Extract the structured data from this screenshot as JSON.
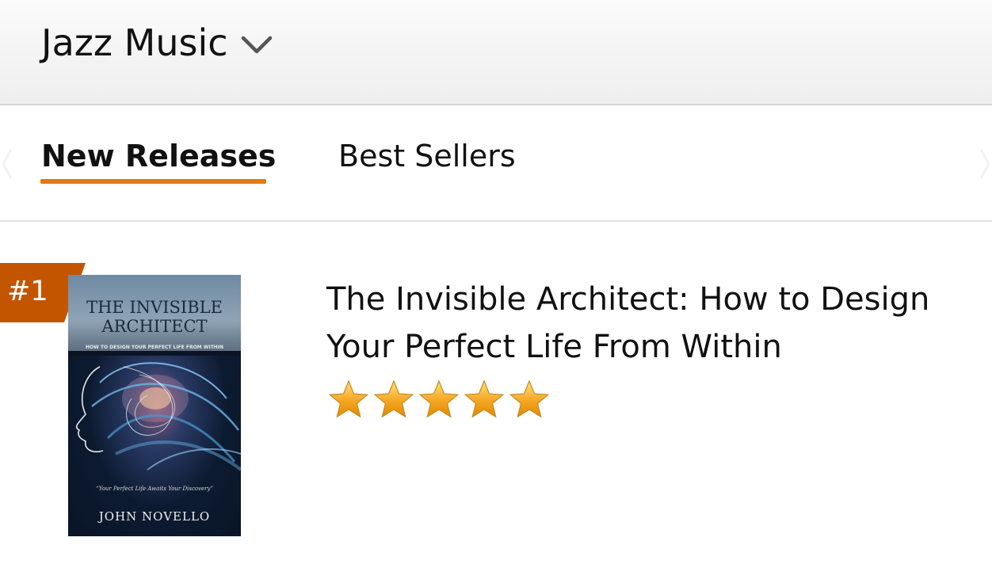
{
  "header": {
    "category": "Jazz Music",
    "dropdown_icon": "chevron-down-icon"
  },
  "tabs": [
    {
      "label": "New Releases",
      "active": true
    },
    {
      "label": "Best Sellers",
      "active": false
    }
  ],
  "colors": {
    "accent": "#e47911",
    "rank_badge": "#c45500",
    "star": "#f5a623"
  },
  "items": [
    {
      "rank": "#1",
      "title": "The Invisible Architect: How to Design Your Perfect Life From Within",
      "rating": 5,
      "rating_max": 5,
      "cover": {
        "title_line1": "THE INVISIBLE",
        "title_line2": "ARCHITECT",
        "subtitle": "HOW TO DESIGN YOUR PERFECT LIFE FROM WITHIN",
        "quote": "“Your Perfect Life Awaits Your Discovery”",
        "author": "JOHN NOVELLO"
      }
    }
  ]
}
